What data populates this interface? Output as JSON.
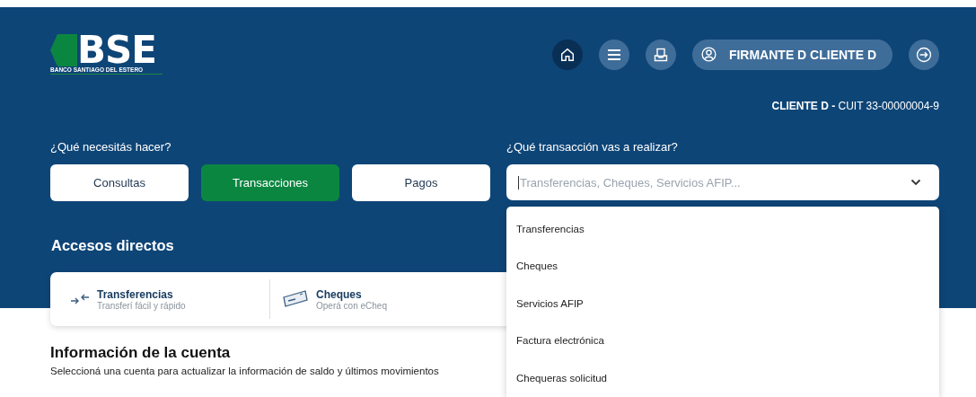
{
  "logo": {
    "mark": "BSE",
    "name": "BANCO SANTIAGO DEL ESTERO"
  },
  "nav": {
    "buttons": [
      {
        "kind": "home",
        "selected": true
      },
      {
        "kind": "menu",
        "selected": false
      },
      {
        "kind": "inbox",
        "selected": false
      }
    ],
    "user": "FIRMANTE D CLIENTE D"
  },
  "client": {
    "name": "CLIENTE D -",
    "cuit": "CUIT 33-00000004-9"
  },
  "categories": {
    "label": "¿Qué necesitás hacer?",
    "options": [
      {
        "label": "Consultas",
        "selected": false
      },
      {
        "label": "Transacciones",
        "selected": true
      },
      {
        "label": "Pagos",
        "selected": false
      }
    ]
  },
  "transaction_select": {
    "label": "¿Qué transacción vas a realizar?",
    "placeholder": "Transferencias, Cheques, Servicios AFIP...",
    "expanded": true,
    "options": [
      "Transferencias",
      "Cheques",
      "Servicios AFIP",
      "Factura electrónica",
      "Chequeras solicitud"
    ]
  },
  "shortcuts": {
    "title": "Accesos directos",
    "items": [
      {
        "kind": "transfer",
        "title": "Transferencias",
        "subtitle": "Transferí fácil y rápido"
      },
      {
        "kind": "cheque",
        "title": "Cheques",
        "subtitle": "Operá con eCheq"
      }
    ]
  },
  "account_info": {
    "title": "Información de la cuenta",
    "subtitle": "Seleccioná una cuenta para actualizar la información de saldo y últimos movimientos"
  }
}
